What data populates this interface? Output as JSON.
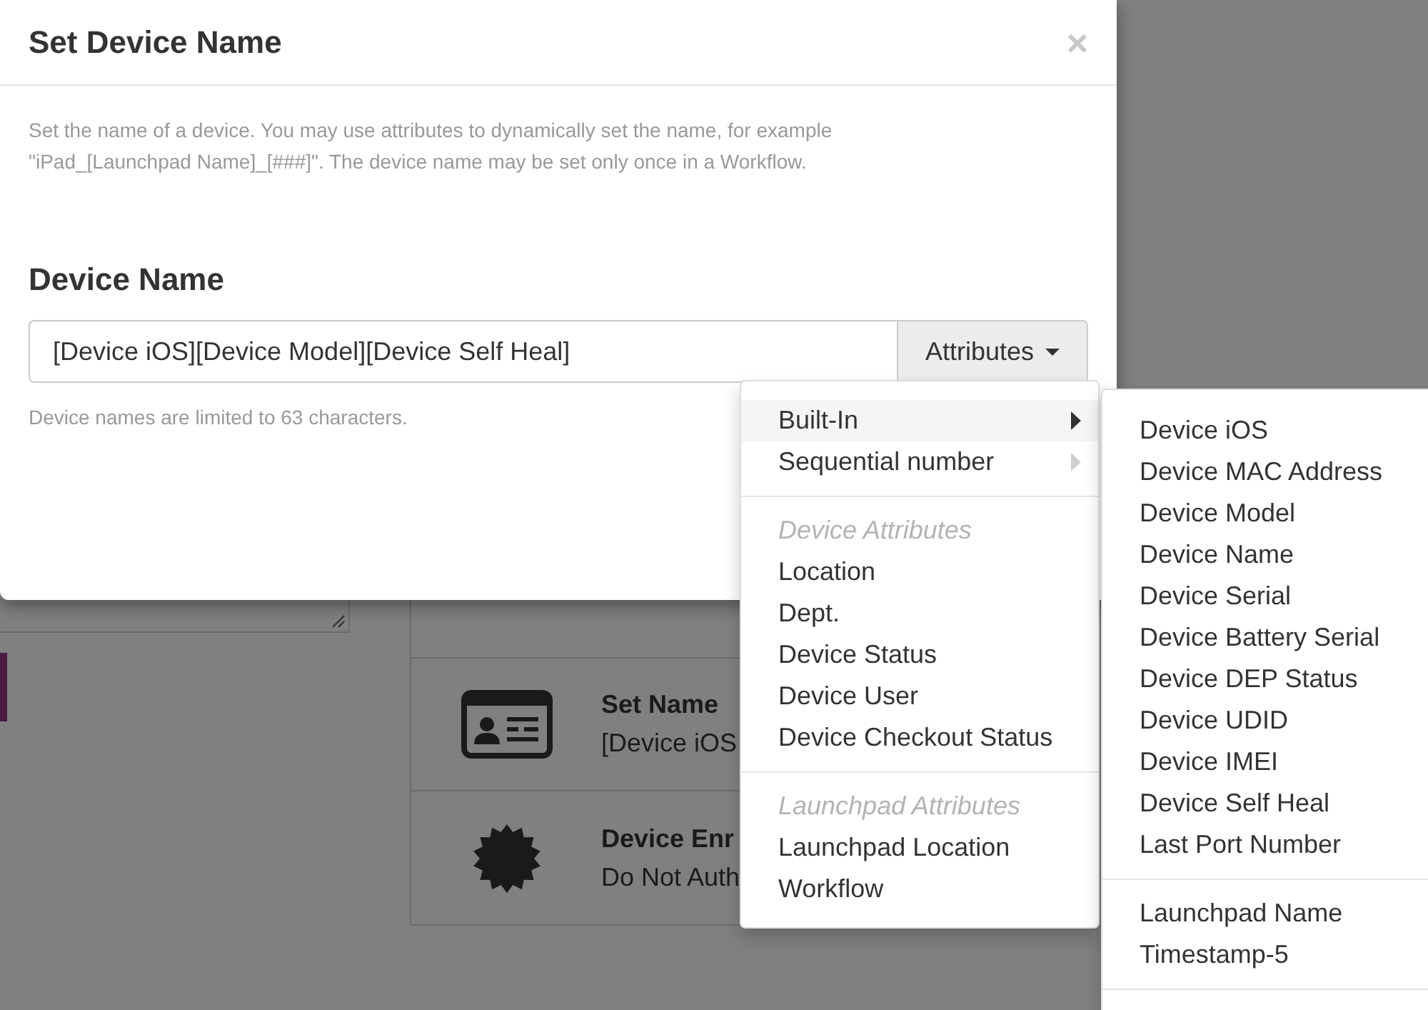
{
  "dialog": {
    "title": "Set Device Name",
    "close": "×",
    "description": "Set the name of a device. You may use attributes to dynamically set the name, for example \"iPad_[Launchpad Name]_[###]\". The device name may be set only once in a Workflow.",
    "field_label": "Device Name",
    "field": {
      "value": "[Device iOS][Device Model][Device Self Heal]"
    },
    "attributes_button": "Attributes",
    "hint": "Device names are limited to 63 characters."
  },
  "attributes_menu": {
    "items": [
      {
        "kind": "submenu",
        "label": "Built-In",
        "selected": true
      },
      {
        "kind": "submenu",
        "label": "Sequential number",
        "selected": false
      },
      {
        "kind": "divider"
      },
      {
        "kind": "header",
        "label": "Device Attributes"
      },
      {
        "kind": "item",
        "label": "Location"
      },
      {
        "kind": "item",
        "label": "Dept."
      },
      {
        "kind": "item",
        "label": "Device Status"
      },
      {
        "kind": "item",
        "label": "Device User"
      },
      {
        "kind": "item",
        "label": "Device Checkout Status"
      },
      {
        "kind": "divider"
      },
      {
        "kind": "header",
        "label": "Launchpad Attributes"
      },
      {
        "kind": "item",
        "label": "Launchpad Location"
      },
      {
        "kind": "item",
        "label": "Workflow"
      }
    ]
  },
  "built_in_submenu": {
    "items": [
      {
        "kind": "item",
        "label": "Device iOS"
      },
      {
        "kind": "item",
        "label": "Device MAC Address"
      },
      {
        "kind": "item",
        "label": "Device Model"
      },
      {
        "kind": "item",
        "label": "Device Name"
      },
      {
        "kind": "item",
        "label": "Device Serial"
      },
      {
        "kind": "item",
        "label": "Device Battery Serial"
      },
      {
        "kind": "item",
        "label": "Device DEP Status"
      },
      {
        "kind": "item",
        "label": "Device UDID"
      },
      {
        "kind": "item",
        "label": "Device IMEI"
      },
      {
        "kind": "item",
        "label": "Device Self Heal"
      },
      {
        "kind": "item",
        "label": "Last Port Number"
      },
      {
        "kind": "divider"
      },
      {
        "kind": "item",
        "label": "Launchpad Name"
      },
      {
        "kind": "item",
        "label": "Timestamp-5"
      },
      {
        "kind": "divider"
      }
    ]
  },
  "background": {
    "steps": [
      {
        "kind": "id-card",
        "title": "Set Name",
        "value": "[Device iOS"
      },
      {
        "kind": "badge",
        "title": "Device Enr",
        "value": "Do Not Auth"
      }
    ]
  }
}
